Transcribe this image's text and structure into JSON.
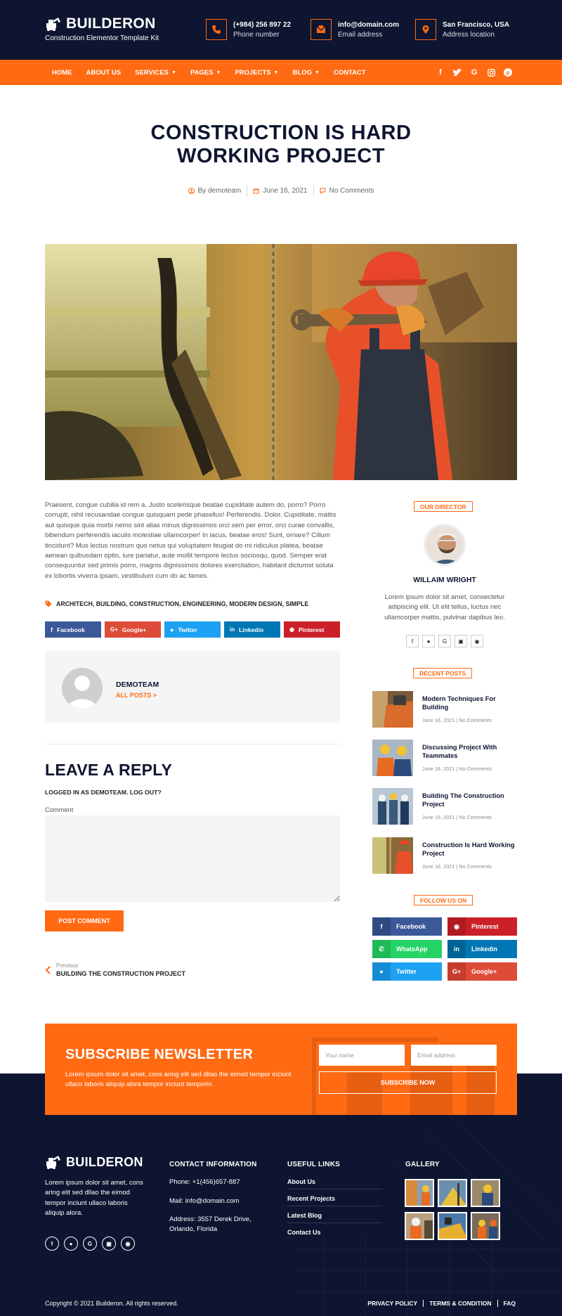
{
  "header": {
    "logo_name": "BUILDERON",
    "logo_tagline": "Construction Elementor Template Kit",
    "contacts": [
      {
        "icon": "phone-icon",
        "line1": "(+984) 256 897 22",
        "line2": "Phone number"
      },
      {
        "icon": "email-icon",
        "line1": "info@domain.com",
        "line2": "Email address"
      },
      {
        "icon": "location-icon",
        "line1": "San Francisco, USA",
        "line2": "Address location"
      }
    ]
  },
  "nav": {
    "items": [
      "HOME",
      "ABOUT US",
      "SERVICES",
      "PAGES",
      "PROJECTS",
      "BLOG",
      "CONTACT"
    ],
    "social": [
      "facebook-icon",
      "twitter-icon",
      "google-icon",
      "instagram-icon",
      "pinterest-icon"
    ]
  },
  "post": {
    "title": "CONSTRUCTION IS HARD WORKING PROJECT",
    "author_meta": "By demoteam",
    "date": "June 16, 2021",
    "comments": "No Comments",
    "body": "Praesent, congue cubilia id rem a. Justo scelerisque beatae cupiditate autem do, porro? Porro corrupti, nihil recusandae congue quisquam pede phasellus! Perferendis. Dolor. Cupiditate, mattis aut quisque quia morbi nemo sint alias minus dignissimos orci sem per error, orci curae convallis, bibendum perferendis iaculis molestiae ullamcorper! In lacus, beatae eros! Sunt, ornare? Cillum tincidunt? Mus lectus nostrum quo netus qui voluptatem feugiat do mi ridiculus platea, beatae aenean quibusdam optio, iure pariatur, aute mollit tempore lectus sociosqu, quod. Semper erat consequuntur sed primis porro, magnis dignissimos dolores exercitation, habitant dictumst soluta ex lobortis viverra ipsam, vestibulum cum do ac fames.",
    "tags": "ARCHITECH, BUILDING, CONSTRUCTION, ENGINEERING, MODERN DESIGN, SIMPLE"
  },
  "share": [
    {
      "label": "Facebook",
      "color": "#3b5998",
      "icon": "facebook-icon"
    },
    {
      "label": "Google+",
      "color": "#dd4b39",
      "icon": "google-plus-icon"
    },
    {
      "label": "Twitter",
      "color": "#1da1f2",
      "icon": "twitter-icon"
    },
    {
      "label": "Linkedin",
      "color": "#0077b5",
      "icon": "linkedin-icon"
    },
    {
      "label": "Pinterest",
      "color": "#cb2027",
      "icon": "pinterest-icon"
    }
  ],
  "author": {
    "name": "DEMOTEAM",
    "posts_link": "ALL POSTS >"
  },
  "reply": {
    "title": "LEAVE A REPLY",
    "logged_in": "LOGGED IN AS DEMOTEAM. LOG OUT?",
    "comment_label": "Comment",
    "comment_value": "",
    "submit": "POST COMMENT"
  },
  "prev_post": {
    "label": "Previous",
    "title": "BUILDING THE CONSTRUCTION PROJECT"
  },
  "sidebar": {
    "director_label": "OUR DIRECTOR",
    "director_name": "WILLAIM WRIGHT",
    "director_bio": "Lorem ipsum dolor sit amet, consectetur adipiscing elit. Ut elit tellus, luctus nec ullamcorper mattis, pulvinar dapibus leo.",
    "director_social": [
      "facebook-icon",
      "twitter-icon",
      "google-icon",
      "instagram-icon",
      "pinterest-icon"
    ],
    "recent_label": "RECENT POSTS",
    "recent_posts": [
      {
        "title": "Modern Techniques For Building",
        "date": "June 16, 2021",
        "comments": "No Comments"
      },
      {
        "title": "Discussing Project With Teammates",
        "date": "June 16, 2021",
        "comments": "No Comments"
      },
      {
        "title": "Building The Construction Project",
        "date": "June 16, 2021",
        "comments": "No Comments"
      },
      {
        "title": "Construction Is Hard Working Project",
        "date": "June 16, 2021",
        "comments": "No Comments"
      }
    ],
    "follow_label": "FOLLOW US ON",
    "follow": [
      {
        "label": "Facebook",
        "color": "#3b5998",
        "icon": "facebook-icon"
      },
      {
        "label": "Pinterest",
        "color": "#cb2027",
        "icon": "pinterest-icon"
      },
      {
        "label": "WhatsApp",
        "color": "#25d366",
        "icon": "whatsapp-icon"
      },
      {
        "label": "Linkedin",
        "color": "#0077b5",
        "icon": "linkedin-icon"
      },
      {
        "label": "Twitter",
        "color": "#1da1f2",
        "icon": "twitter-icon"
      },
      {
        "label": "Google+",
        "color": "#dd4b39",
        "icon": "google-plus-icon"
      }
    ]
  },
  "newsletter": {
    "title": "SUBSCRIBE NEWSLETTER",
    "text": "Lorem ipsum dolor sit amet, cons aring elit sed dllao the eimod tempor inciunt ullaco laboris aliquip alora tempor inciunt temporin.",
    "name_placeholder": "Your name",
    "email_placeholder": "Email address",
    "button": "SUBSCRIBE NOW"
  },
  "footer": {
    "logo_name": "BUILDERON",
    "about": "Lorem ipsum dolor sit amet, cons aring elit sed dllao the eimod tempor inciunt ullaco laboris aliquip alora.",
    "contact_heading": "CONTACT INFORMATION",
    "phone": "Phone: +1(456)657-887",
    "mail": "Mail: info@domain.com",
    "address": "Address: 3557 Derek Drive, Orlando, Florida",
    "links_heading": "USEFUL LINKS",
    "links": [
      "About Us",
      "Recent Projects",
      "Latest Blog",
      "Contact Us"
    ],
    "gallery_heading": "GALLERY",
    "copyright": "Copyright © 2021 Builderon. All rights reserved.",
    "legal": [
      "PRIVACY POLICY",
      "TERMS & CONDITION",
      "FAQ"
    ]
  },
  "colors": {
    "accent": "#ff6a13",
    "navy": "#0d1530"
  }
}
